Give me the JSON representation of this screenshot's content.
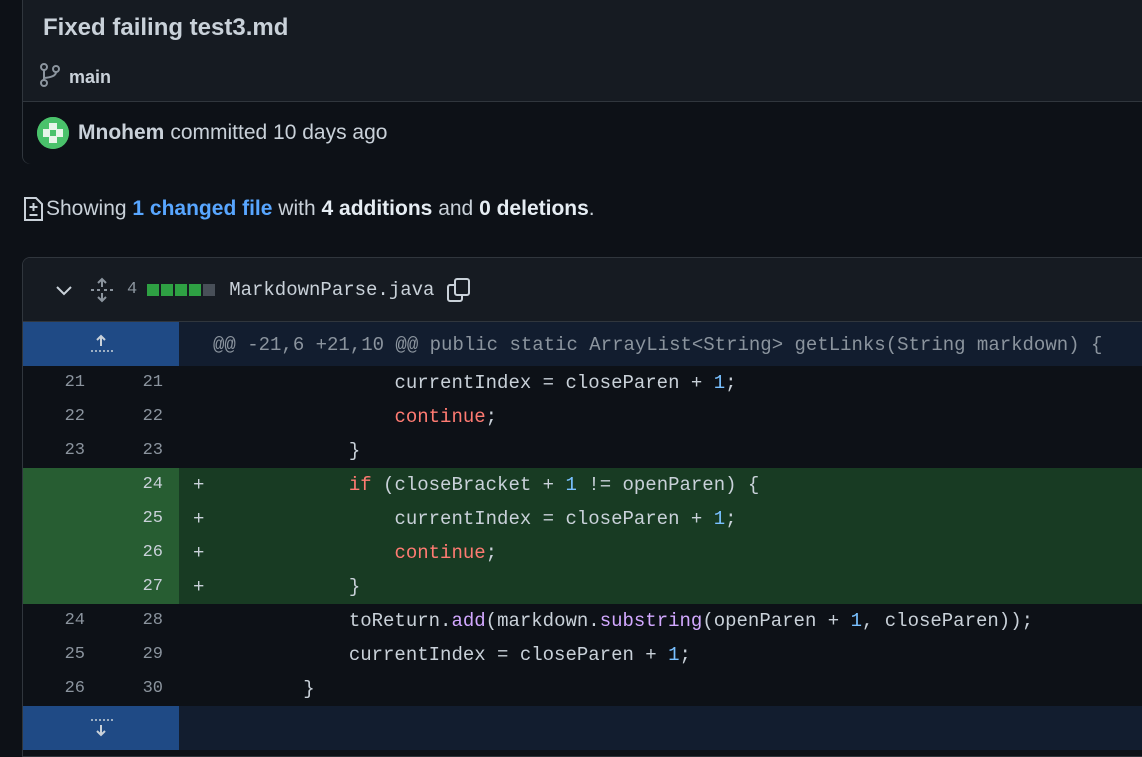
{
  "commit": {
    "title": "Fixed failing test3.md",
    "branch": "main",
    "author": "Mnohem",
    "action": "committed 10 days ago"
  },
  "summary": {
    "prefix": "Showing",
    "link": "1 changed file",
    "with": "with",
    "additions": "4 additions",
    "and": "and",
    "deletions": "0 deletions",
    "period": "."
  },
  "file": {
    "change_count": "4",
    "name": "MarkdownParse.java",
    "hunk": "@@ -21,6 +21,10 @@ public static ArrayList<String> getLinks(String markdown) {",
    "lines": [
      {
        "old": "21",
        "new": "21",
        "type": "context",
        "indent": "                ",
        "tokens": [
          {
            "t": "currentIndex = closeParen + "
          },
          {
            "t": "1",
            "c": "num"
          },
          {
            "t": ";"
          }
        ]
      },
      {
        "old": "22",
        "new": "22",
        "type": "context",
        "indent": "                ",
        "tokens": [
          {
            "t": "continue",
            "c": "kw"
          },
          {
            "t": ";"
          }
        ]
      },
      {
        "old": "23",
        "new": "23",
        "type": "context",
        "indent": "            ",
        "tokens": [
          {
            "t": "}"
          }
        ]
      },
      {
        "old": "",
        "new": "24",
        "type": "add",
        "indent": "            ",
        "tokens": [
          {
            "t": "if",
            "c": "kw"
          },
          {
            "t": " (closeBracket + "
          },
          {
            "t": "1",
            "c": "num"
          },
          {
            "t": " != openParen) {"
          }
        ]
      },
      {
        "old": "",
        "new": "25",
        "type": "add",
        "indent": "                ",
        "tokens": [
          {
            "t": "currentIndex = closeParen + "
          },
          {
            "t": "1",
            "c": "num"
          },
          {
            "t": ";"
          }
        ]
      },
      {
        "old": "",
        "new": "26",
        "type": "add",
        "indent": "                ",
        "tokens": [
          {
            "t": "continue",
            "c": "kw"
          },
          {
            "t": ";"
          }
        ]
      },
      {
        "old": "",
        "new": "27",
        "type": "add",
        "indent": "            ",
        "tokens": [
          {
            "t": "}"
          }
        ]
      },
      {
        "old": "24",
        "new": "28",
        "type": "context",
        "indent": "            ",
        "tokens": [
          {
            "t": "toReturn."
          },
          {
            "t": "add",
            "c": "fn"
          },
          {
            "t": "(markdown."
          },
          {
            "t": "substring",
            "c": "fn"
          },
          {
            "t": "(openParen + "
          },
          {
            "t": "1",
            "c": "num"
          },
          {
            "t": ", closeParen));"
          }
        ]
      },
      {
        "old": "25",
        "new": "29",
        "type": "context",
        "indent": "            ",
        "tokens": [
          {
            "t": "currentIndex = closeParen + "
          },
          {
            "t": "1",
            "c": "num"
          },
          {
            "t": ";"
          }
        ]
      },
      {
        "old": "26",
        "new": "30",
        "type": "context",
        "indent": "        ",
        "tokens": [
          {
            "t": "}"
          }
        ]
      }
    ],
    "add_marker": "+"
  },
  "colors": {
    "accent": "#58a6ff",
    "addition": "#2ea043",
    "neutral": "#484f58"
  }
}
